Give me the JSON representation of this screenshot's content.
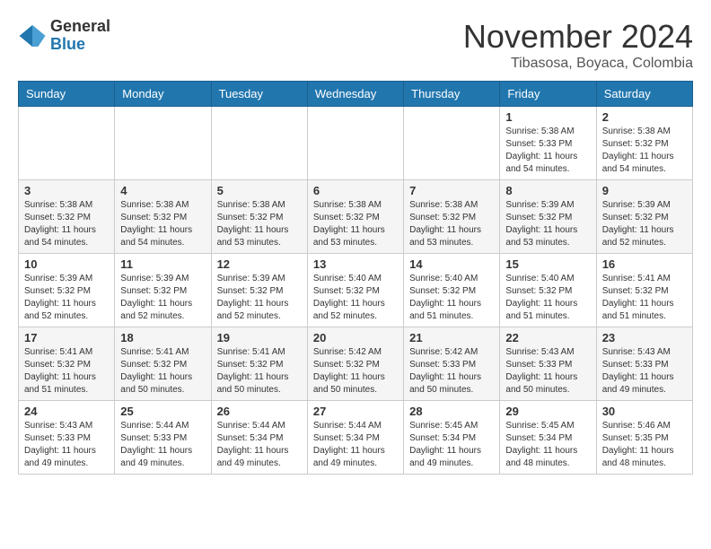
{
  "logo": {
    "general": "General",
    "blue": "Blue"
  },
  "header": {
    "month_year": "November 2024",
    "location": "Tibasosa, Boyaca, Colombia"
  },
  "weekdays": [
    "Sunday",
    "Monday",
    "Tuesday",
    "Wednesday",
    "Thursday",
    "Friday",
    "Saturday"
  ],
  "weeks": [
    [
      {
        "day": "",
        "info": ""
      },
      {
        "day": "",
        "info": ""
      },
      {
        "day": "",
        "info": ""
      },
      {
        "day": "",
        "info": ""
      },
      {
        "day": "",
        "info": ""
      },
      {
        "day": "1",
        "info": "Sunrise: 5:38 AM\nSunset: 5:33 PM\nDaylight: 11 hours\nand 54 minutes."
      },
      {
        "day": "2",
        "info": "Sunrise: 5:38 AM\nSunset: 5:32 PM\nDaylight: 11 hours\nand 54 minutes."
      }
    ],
    [
      {
        "day": "3",
        "info": "Sunrise: 5:38 AM\nSunset: 5:32 PM\nDaylight: 11 hours\nand 54 minutes."
      },
      {
        "day": "4",
        "info": "Sunrise: 5:38 AM\nSunset: 5:32 PM\nDaylight: 11 hours\nand 54 minutes."
      },
      {
        "day": "5",
        "info": "Sunrise: 5:38 AM\nSunset: 5:32 PM\nDaylight: 11 hours\nand 53 minutes."
      },
      {
        "day": "6",
        "info": "Sunrise: 5:38 AM\nSunset: 5:32 PM\nDaylight: 11 hours\nand 53 minutes."
      },
      {
        "day": "7",
        "info": "Sunrise: 5:38 AM\nSunset: 5:32 PM\nDaylight: 11 hours\nand 53 minutes."
      },
      {
        "day": "8",
        "info": "Sunrise: 5:39 AM\nSunset: 5:32 PM\nDaylight: 11 hours\nand 53 minutes."
      },
      {
        "day": "9",
        "info": "Sunrise: 5:39 AM\nSunset: 5:32 PM\nDaylight: 11 hours\nand 52 minutes."
      }
    ],
    [
      {
        "day": "10",
        "info": "Sunrise: 5:39 AM\nSunset: 5:32 PM\nDaylight: 11 hours\nand 52 minutes."
      },
      {
        "day": "11",
        "info": "Sunrise: 5:39 AM\nSunset: 5:32 PM\nDaylight: 11 hours\nand 52 minutes."
      },
      {
        "day": "12",
        "info": "Sunrise: 5:39 AM\nSunset: 5:32 PM\nDaylight: 11 hours\nand 52 minutes."
      },
      {
        "day": "13",
        "info": "Sunrise: 5:40 AM\nSunset: 5:32 PM\nDaylight: 11 hours\nand 52 minutes."
      },
      {
        "day": "14",
        "info": "Sunrise: 5:40 AM\nSunset: 5:32 PM\nDaylight: 11 hours\nand 51 minutes."
      },
      {
        "day": "15",
        "info": "Sunrise: 5:40 AM\nSunset: 5:32 PM\nDaylight: 11 hours\nand 51 minutes."
      },
      {
        "day": "16",
        "info": "Sunrise: 5:41 AM\nSunset: 5:32 PM\nDaylight: 11 hours\nand 51 minutes."
      }
    ],
    [
      {
        "day": "17",
        "info": "Sunrise: 5:41 AM\nSunset: 5:32 PM\nDaylight: 11 hours\nand 51 minutes."
      },
      {
        "day": "18",
        "info": "Sunrise: 5:41 AM\nSunset: 5:32 PM\nDaylight: 11 hours\nand 50 minutes."
      },
      {
        "day": "19",
        "info": "Sunrise: 5:41 AM\nSunset: 5:32 PM\nDaylight: 11 hours\nand 50 minutes."
      },
      {
        "day": "20",
        "info": "Sunrise: 5:42 AM\nSunset: 5:32 PM\nDaylight: 11 hours\nand 50 minutes."
      },
      {
        "day": "21",
        "info": "Sunrise: 5:42 AM\nSunset: 5:33 PM\nDaylight: 11 hours\nand 50 minutes."
      },
      {
        "day": "22",
        "info": "Sunrise: 5:43 AM\nSunset: 5:33 PM\nDaylight: 11 hours\nand 50 minutes."
      },
      {
        "day": "23",
        "info": "Sunrise: 5:43 AM\nSunset: 5:33 PM\nDaylight: 11 hours\nand 49 minutes."
      }
    ],
    [
      {
        "day": "24",
        "info": "Sunrise: 5:43 AM\nSunset: 5:33 PM\nDaylight: 11 hours\nand 49 minutes."
      },
      {
        "day": "25",
        "info": "Sunrise: 5:44 AM\nSunset: 5:33 PM\nDaylight: 11 hours\nand 49 minutes."
      },
      {
        "day": "26",
        "info": "Sunrise: 5:44 AM\nSunset: 5:34 PM\nDaylight: 11 hours\nand 49 minutes."
      },
      {
        "day": "27",
        "info": "Sunrise: 5:44 AM\nSunset: 5:34 PM\nDaylight: 11 hours\nand 49 minutes."
      },
      {
        "day": "28",
        "info": "Sunrise: 5:45 AM\nSunset: 5:34 PM\nDaylight: 11 hours\nand 49 minutes."
      },
      {
        "day": "29",
        "info": "Sunrise: 5:45 AM\nSunset: 5:34 PM\nDaylight: 11 hours\nand 48 minutes."
      },
      {
        "day": "30",
        "info": "Sunrise: 5:46 AM\nSunset: 5:35 PM\nDaylight: 11 hours\nand 48 minutes."
      }
    ]
  ]
}
